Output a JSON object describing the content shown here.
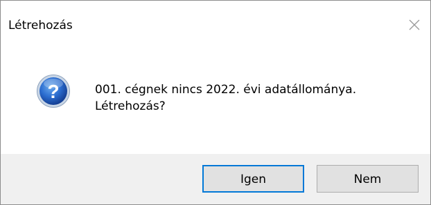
{
  "window": {
    "title": "Létrehozás",
    "close_icon": "close-icon"
  },
  "message": {
    "icon": "question-icon",
    "line1": "001. cégnek nincs 2022. évi adatállománya.",
    "line2": "Létrehozás?"
  },
  "buttons": {
    "yes_label": "Igen",
    "no_label": "Nem"
  },
  "colors": {
    "accent": "#0078d7",
    "footer_bg": "#f0f0f0",
    "button_bg": "#e1e1e1"
  }
}
